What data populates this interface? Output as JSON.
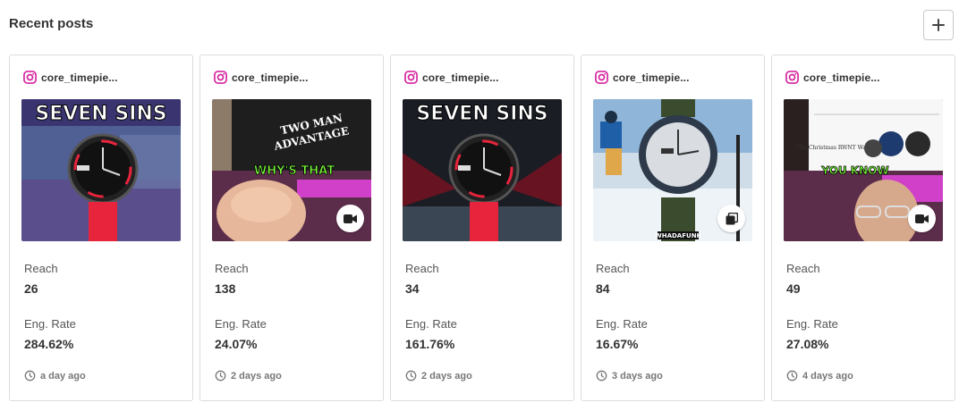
{
  "header": {
    "title": "Recent posts",
    "add_button": "+"
  },
  "posts": [
    {
      "account": "core_timepie...",
      "reach_label": "Reach",
      "reach": "26",
      "eng_label": "Eng. Rate",
      "eng_rate": "284.62%",
      "time": "a day ago",
      "media": "image",
      "thumb_text": "SEVEN SINS"
    },
    {
      "account": "core_timepie...",
      "reach_label": "Reach",
      "reach": "138",
      "eng_label": "Eng. Rate",
      "eng_rate": "24.07%",
      "time": "2 days ago",
      "media": "video",
      "thumb_text": "WHY'S THAT",
      "thumb_shirt": "TWO MAN ADVANTAGE"
    },
    {
      "account": "core_timepie...",
      "reach_label": "Reach",
      "reach": "34",
      "eng_label": "Eng. Rate",
      "eng_rate": "161.76%",
      "time": "2 days ago",
      "media": "image",
      "thumb_text": "SEVEN SINS"
    },
    {
      "account": "core_timepie...",
      "reach_label": "Reach",
      "reach": "84",
      "eng_label": "Eng. Rate",
      "eng_rate": "16.67%",
      "time": "3 days ago",
      "media": "carousel",
      "thumb_text": "WHADAFUNK"
    },
    {
      "account": "core_timepie...",
      "reach_label": "Reach",
      "reach": "49",
      "eng_label": "Eng. Rate",
      "eng_rate": "27.08%",
      "time": "4 days ago",
      "media": "video",
      "thumb_text": "YOU KNOW",
      "thumb_page": "\"The Christmas RWNT Watch\""
    }
  ],
  "colors": {
    "instagram": "#d6249f",
    "accent_red": "#e8243c",
    "magenta": "#c43ab8",
    "text": "#333333",
    "muted": "#777777"
  },
  "icons": {
    "instagram": "instagram-icon",
    "clock": "clock-icon",
    "video": "video-icon",
    "carousel": "carousel-icon",
    "add": "plus-icon"
  }
}
